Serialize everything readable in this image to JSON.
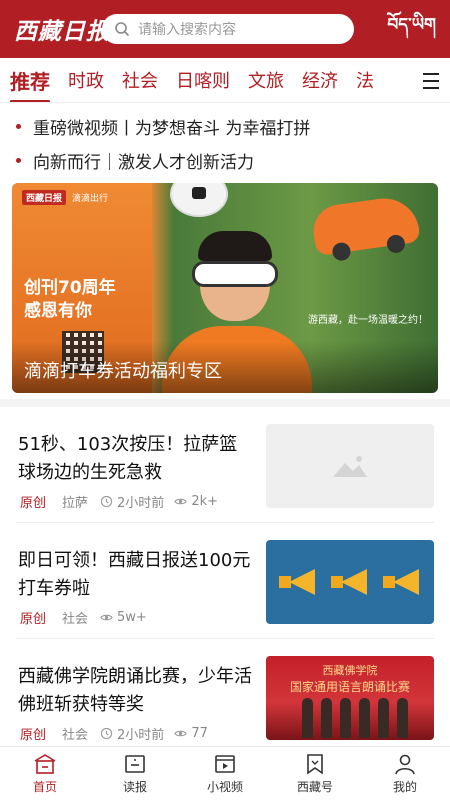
{
  "header": {
    "logo": "西藏日报",
    "search_placeholder": "请输入搜索内容",
    "tibetan_label": "བོད་ཡིག"
  },
  "tabs": [
    "推荐",
    "时政",
    "社会",
    "日喀则",
    "文旅",
    "经济",
    "法"
  ],
  "headlines": [
    "重磅微视频丨为梦想奋斗 为幸福打拼",
    "向新而行｜激发人才创新活力"
  ],
  "banner": {
    "brand_left": "西藏日报",
    "brand_right": "滴滴出行",
    "anniversary": "创刊70周年",
    "thanks": "感恩有你",
    "slogan": "游西藏，赴一场温暖之约！",
    "caption": "滴滴打车券活动福利专区"
  },
  "news": [
    {
      "title": "51秒、103次按压！拉萨篮球场边的生死急救",
      "original": "原创",
      "category": "拉萨",
      "time": "2小时前",
      "views": "2k+",
      "thumb": "placeholder"
    },
    {
      "title": "即日可领！西藏日报送100元打车券啦",
      "original": "原创",
      "category": "社会",
      "time": "",
      "views": "5w+",
      "thumb": "megaphones"
    },
    {
      "title": "西藏佛学院朗诵比赛，少年活佛班斩获特等奖",
      "original": "原创",
      "category": "社会",
      "time": "2小时前",
      "views": "77",
      "thumb": "stage",
      "thumb_text1": "西藏佛学院",
      "thumb_text2": "国家通用语言朗诵比赛"
    }
  ],
  "bottom_nav": [
    {
      "label": "首页",
      "icon": "home-icon"
    },
    {
      "label": "读报",
      "icon": "newspaper-icon"
    },
    {
      "label": "小视频",
      "icon": "video-icon"
    },
    {
      "label": "西藏号",
      "icon": "bookmark-icon"
    },
    {
      "label": "我的",
      "icon": "user-icon"
    }
  ],
  "colors": {
    "brand": "#b11e23"
  }
}
